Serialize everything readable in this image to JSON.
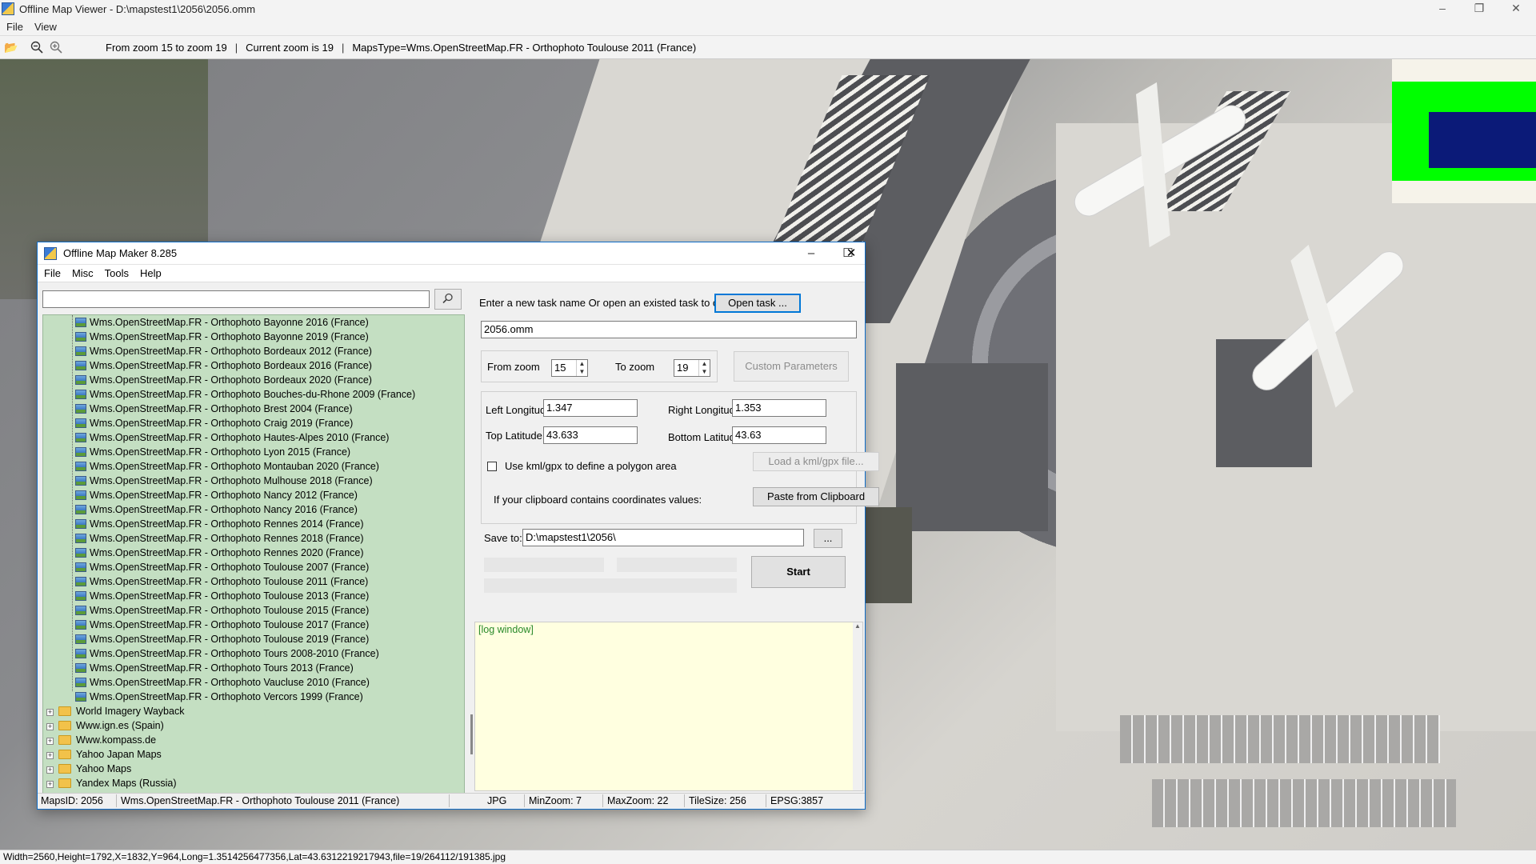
{
  "viewer": {
    "title": "Offline Map Viewer - D:\\mapstest1\\2056\\2056.omm",
    "menu": [
      "File",
      "View"
    ],
    "toolbar": {
      "zoom_range": "From zoom 15 to zoom 19",
      "current_zoom": "Current zoom is 19",
      "maps_type": "MapsType=Wms.OpenStreetMap.FR - Orthophoto Toulouse 2011 (France)"
    },
    "status": "Width=2560,Height=1792,X=1832,Y=964,Long=1.3514256477356,Lat=43.6312219217943,file=19/264112/191385.jpg",
    "icons": [
      "open-folder-icon",
      "zoom-out-icon",
      "zoom-in-icon"
    ]
  },
  "dialog": {
    "title": "Offline Map Maker 8.285",
    "menu": [
      "File",
      "Misc",
      "Tools",
      "Help"
    ],
    "tree": {
      "leaves": [
        "Wms.OpenStreetMap.FR - Orthophoto Bayonne 2016 (France)",
        "Wms.OpenStreetMap.FR - Orthophoto Bayonne 2019 (France)",
        "Wms.OpenStreetMap.FR - Orthophoto Bordeaux 2012 (France)",
        "Wms.OpenStreetMap.FR - Orthophoto Bordeaux 2016 (France)",
        "Wms.OpenStreetMap.FR - Orthophoto Bordeaux 2020 (France)",
        "Wms.OpenStreetMap.FR - Orthophoto Bouches-du-Rhone 2009 (France)",
        "Wms.OpenStreetMap.FR - Orthophoto Brest 2004 (France)",
        "Wms.OpenStreetMap.FR - Orthophoto Craig 2019 (France)",
        "Wms.OpenStreetMap.FR - Orthophoto Hautes-Alpes 2010 (France)",
        "Wms.OpenStreetMap.FR - Orthophoto Lyon 2015 (France)",
        "Wms.OpenStreetMap.FR - Orthophoto Montauban 2020 (France)",
        "Wms.OpenStreetMap.FR - Orthophoto Mulhouse 2018 (France)",
        "Wms.OpenStreetMap.FR - Orthophoto Nancy 2012 (France)",
        "Wms.OpenStreetMap.FR - Orthophoto Nancy 2016 (France)",
        "Wms.OpenStreetMap.FR - Orthophoto Rennes 2014 (France)",
        "Wms.OpenStreetMap.FR - Orthophoto Rennes 2018 (France)",
        "Wms.OpenStreetMap.FR - Orthophoto Rennes 2020 (France)",
        "Wms.OpenStreetMap.FR - Orthophoto Toulouse 2007 (France)",
        "Wms.OpenStreetMap.FR - Orthophoto Toulouse 2011 (France)",
        "Wms.OpenStreetMap.FR - Orthophoto Toulouse 2013 (France)",
        "Wms.OpenStreetMap.FR - Orthophoto Toulouse 2015 (France)",
        "Wms.OpenStreetMap.FR - Orthophoto Toulouse 2017 (France)",
        "Wms.OpenStreetMap.FR - Orthophoto Toulouse 2019 (France)",
        "Wms.OpenStreetMap.FR - Orthophoto Tours 2008-2010 (France)",
        "Wms.OpenStreetMap.FR - Orthophoto Tours 2013 (France)",
        "Wms.OpenStreetMap.FR - Orthophoto Vaucluse 2010 (France)",
        "Wms.OpenStreetMap.FR - Orthophoto Vercors 1999 (France)"
      ],
      "folders": [
        "World Imagery Wayback",
        "Www.ign.es (Spain)",
        "Www.kompass.de",
        "Yahoo Japan Maps",
        "Yahoo Maps",
        "Yandex Maps (Russia)"
      ],
      "selected": "Wms.OpenStreetMap.FR - Orthophoto Toulouse 2011 (France)"
    },
    "task": {
      "prompt": "Enter a new task name Or open an existed task to continue:",
      "open_button": "Open task ...",
      "name": "2056.omm"
    },
    "zoom": {
      "from_label": "From zoom",
      "from_value": "15",
      "to_label": "To zoom",
      "to_value": "19",
      "custom_button": "Custom Parameters"
    },
    "coords": {
      "left_lon_label": "Left Longitude",
      "left_lon": "1.347",
      "right_lon_label": "Right Longitude",
      "right_lon": "1.353",
      "top_lat_label": "Top Latitude",
      "top_lat": "43.633",
      "bottom_lat_label": "Bottom Latitude",
      "bottom_lat": "43.63",
      "kml_label": "Use kml/gpx to define a polygon area",
      "kml_button": "Load a kml/gpx file...",
      "clipboard_label": "If your clipboard contains coordinates values:",
      "clipboard_button": "Paste from Clipboard"
    },
    "save": {
      "label": "Save to:",
      "path": "D:\\mapstest1\\2056\\",
      "browse": "...",
      "start": "Start"
    },
    "log": "[log window]",
    "status": {
      "maps_id": "MapsID: 2056",
      "name": "Wms.OpenStreetMap.FR - Orthophoto Toulouse 2011 (France)",
      "format": "JPG",
      "min_zoom": "MinZoom: 7",
      "max_zoom": "MaxZoom: 22",
      "tile_size": "TileSize: 256",
      "epsg": "EPSG:3857"
    }
  },
  "colors": {
    "tree_bg": "#c4dfc2",
    "log_bg": "#ffffe0",
    "log_text": "#2a8a2a",
    "overview_green": "#00ff00",
    "overview_blue": "#0b1a78"
  }
}
